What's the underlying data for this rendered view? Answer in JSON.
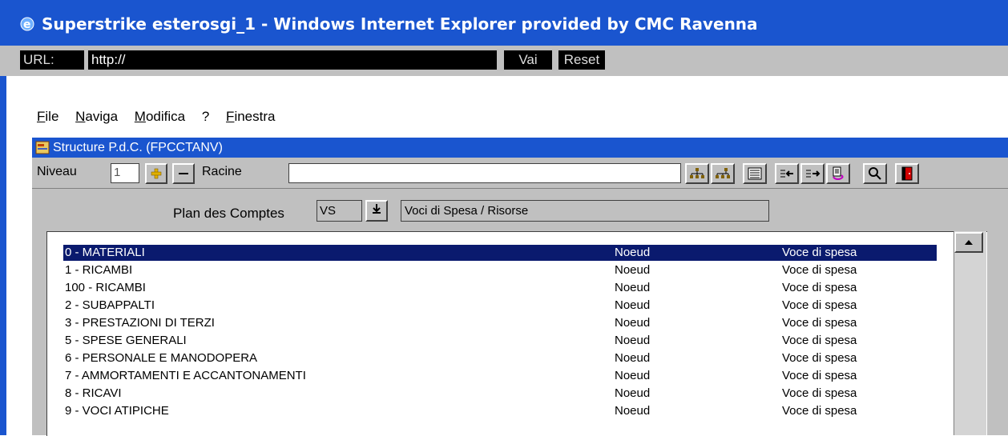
{
  "window": {
    "title": "Superstrike esterosgi_1 - Windows Internet Explorer provided by CMC Ravenna"
  },
  "urlbar": {
    "label": "URL:",
    "value": "http://",
    "go_label": "Vai",
    "reset_label": "Reset"
  },
  "menu": [
    "File",
    "Naviga",
    "Modifica",
    "?",
    "Finestra"
  ],
  "form": {
    "title": "Structure P.d.C. (FPCCTANV)",
    "level_label": "Niveau",
    "level_value": "1",
    "root_label": "Racine",
    "root_value": "",
    "plan_label": "Plan des Comptes",
    "plan_code": "VS",
    "plan_desc": "Voci di Spesa / Risorse"
  },
  "accounts": [
    {
      "name": "0 - MATERIALI",
      "type": "Noeud",
      "category": "Voce di spesa",
      "selected": true
    },
    {
      "name": "1 - RICAMBI",
      "type": "Noeud",
      "category": "Voce di spesa"
    },
    {
      "name": "100 - RICAMBI",
      "type": "Noeud",
      "category": "Voce di spesa"
    },
    {
      "name": "2 - SUBAPPALTI",
      "type": "Noeud",
      "category": "Voce di spesa"
    },
    {
      "name": "3 - PRESTAZIONI DI TERZI",
      "type": "Noeud",
      "category": "Voce di spesa"
    },
    {
      "name": "5 - SPESE GENERALI",
      "type": "Noeud",
      "category": "Voce di spesa"
    },
    {
      "name": "6 - PERSONALE E MANODOPERA",
      "type": "Noeud",
      "category": "Voce di spesa"
    },
    {
      "name": "7 - AMMORTAMENTI E ACCANTONAMENTI",
      "type": "Noeud",
      "category": "Voce di spesa"
    },
    {
      "name": "8 - RICAVI",
      "type": "Noeud",
      "category": "Voce di spesa"
    },
    {
      "name": "9 - VOCI ATIPICHE",
      "type": "Noeud",
      "category": "Voce di spesa"
    }
  ],
  "colors": {
    "titlebar": "#1a55cf",
    "selection": "#0a1a6e",
    "panel": "#c0c0c0"
  }
}
